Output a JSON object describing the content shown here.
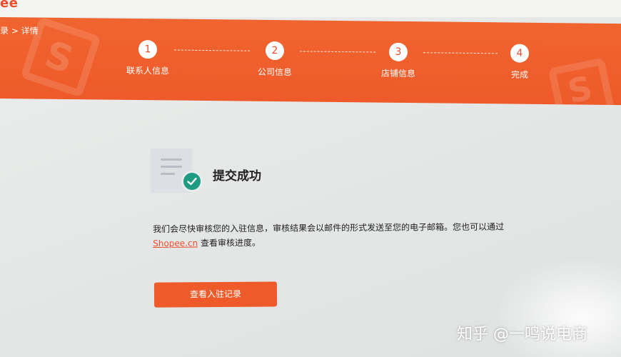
{
  "header": {
    "logo": "ee"
  },
  "banner": {
    "breadcrumb": "录 > 详情",
    "steps": [
      {
        "num": "1",
        "label": "联系人信息"
      },
      {
        "num": "2",
        "label": "公司信息"
      },
      {
        "num": "3",
        "label": "店铺信息"
      },
      {
        "num": "4",
        "label": "完成"
      }
    ]
  },
  "result": {
    "title": "提交成功",
    "description_line1": "我们会尽快审核您的入驻信息，审核结果会以邮件的形式发送至您的电子邮箱。您也可以通过",
    "link_text": "Shopee.cn",
    "description_line2_suffix": " 查看审核进度。",
    "button_label": "查看入驻记录"
  },
  "watermark": "知乎 @一鸣说电商",
  "colors": {
    "accent": "#ee4d2d",
    "success": "#1f9a83"
  }
}
